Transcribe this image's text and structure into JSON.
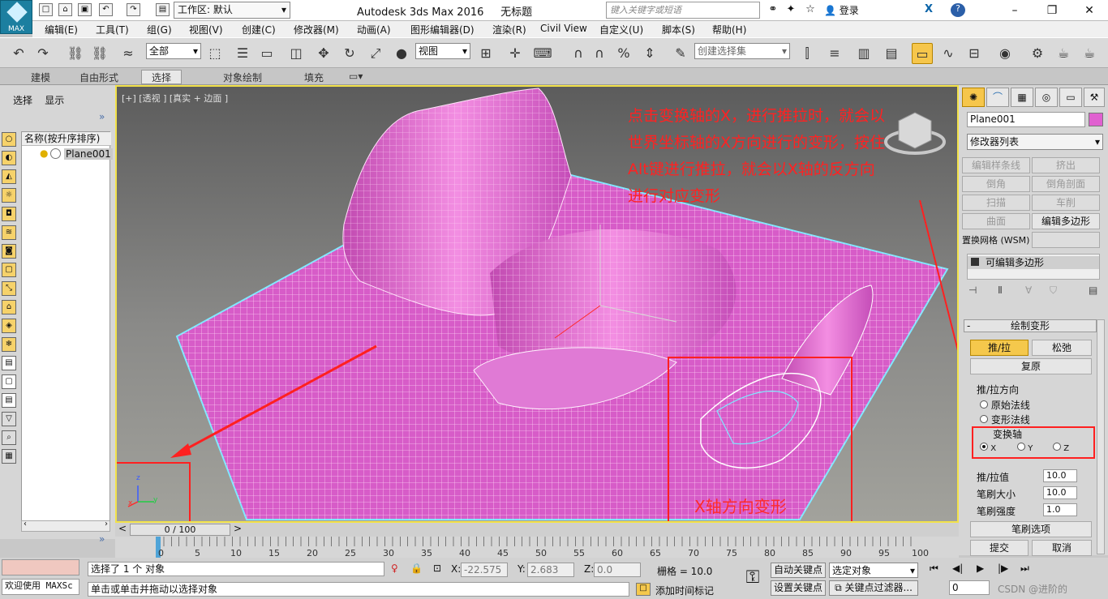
{
  "titlebar": {
    "logo_text": "MAX",
    "workspace_label": "工作区: 默认",
    "app_title": "Autodesk 3ds Max 2016",
    "doc_title": "无标题",
    "search_placeholder": "键入关键字或短语",
    "login": "登录"
  },
  "menu": [
    "编辑(E)",
    "工具(T)",
    "组(G)",
    "视图(V)",
    "创建(C)",
    "修改器(M)",
    "动画(A)",
    "图形编辑器(D)",
    "渲染(R)",
    "Civil View",
    "自定义(U)",
    "脚本(S)",
    "帮助(H)"
  ],
  "toolbar": {
    "filter": "全部",
    "ref_coord": "视图",
    "named_sel": "创建选择集"
  },
  "ribbon_tabs": [
    "建模",
    "自由形式",
    "选择",
    "对象绘制",
    "填充"
  ],
  "ribbon_active": "选择",
  "left_panel": {
    "select": "选择",
    "display": "显示",
    "column_header": "名称(按升序排序)",
    "object": "Plane001",
    "frame": "0 / 100"
  },
  "viewport": {
    "label": "[+] [透视 ] [真实 + 边面 ]",
    "annotation": "点击变换轴的X，进行推拉时，就会以世界坐标轴的X方向进行的变形，按住Alt键进行推拉，就会以X轴的反方向进行对应变形",
    "x_label": "X轴方向变形",
    "axis_x": "x",
    "axis_y": "y",
    "axis_z": "z"
  },
  "right_panel": {
    "object_name": "Plane001",
    "object_color": "#e060d0",
    "modifier_list": "修改器列表",
    "btns": [
      "编辑样条线",
      "挤出",
      "倒角",
      "倒角剖面",
      "扫描",
      "车削",
      "曲面",
      "编辑多边形"
    ],
    "displace_mesh": "置换网格 (WSM)",
    "stack_item": "可编辑多边形",
    "rollout": "绘制变形",
    "push_pull": "推/拉",
    "relax": "松弛",
    "revert": "复原",
    "direction_label": "推/拉方向",
    "opt_original": "原始法线",
    "opt_deformed": "变形法线",
    "opt_axis": "变换轴",
    "axis_x": "X",
    "axis_y": "Y",
    "axis_z": "Z",
    "value_label": "推/拉值",
    "value": "10.0",
    "size_label": "笔刷大小",
    "size": "10.0",
    "strength_label": "笔刷强度",
    "strength": "1.0",
    "brush_options": "笔刷选项",
    "commit": "提交",
    "cancel": "取消"
  },
  "timeline_ticks": [
    "0",
    "5",
    "10",
    "15",
    "20",
    "25",
    "30",
    "35",
    "40",
    "45",
    "50",
    "55",
    "60",
    "65",
    "70",
    "75",
    "80",
    "85",
    "90",
    "95",
    "100"
  ],
  "status": {
    "welcome": "欢迎使用 MAXSc",
    "selected": "选择了 1 个 对象",
    "prompt": "单击或单击并拖动以选择对象",
    "x_label": "X:",
    "x_val": "-22.575",
    "y_label": "Y:",
    "y_val": "2.683",
    "z_label": "Z:",
    "z_val": "0.0",
    "grid": "栅格 = 10.0",
    "auto_key": "自动关键点",
    "set_key": "设置关键点",
    "sel_obj": "选定对象",
    "key_filter": "关键点过滤器...",
    "add_time_tag": "添加时间标记",
    "frame_field": "0",
    "watermark": "CSDN @进阶的"
  }
}
